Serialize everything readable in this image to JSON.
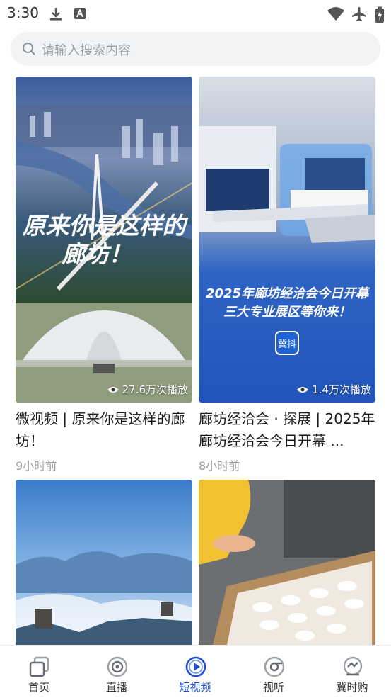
{
  "status_bar": {
    "time": "3:30"
  },
  "search": {
    "placeholder": "请输入搜索内容"
  },
  "feed": [
    {
      "overlay_text": "原来你是这样的廊坊！",
      "play_count": "27.6万次播放",
      "title": "微视频 | 原来你是这样的廊坊！",
      "time": "9小时前"
    },
    {
      "overlay_text": "2025年廊坊经洽会今日开幕 三大专业展区等你来！",
      "badge": "冀抖",
      "play_count": "1.4万次播放",
      "title": "廊坊经洽会 · 探展 | 2025年廊坊经洽会今日开幕 ...",
      "time": "8小时前"
    },
    {
      "title": "",
      "time": ""
    },
    {
      "title": "",
      "time": ""
    }
  ],
  "tabbar": {
    "items": [
      {
        "label": "首页",
        "icon": "home-icon"
      },
      {
        "label": "直播",
        "icon": "live-icon"
      },
      {
        "label": "短视频",
        "icon": "short-video-icon",
        "active": true
      },
      {
        "label": "视听",
        "icon": "audio-visual-icon"
      },
      {
        "label": "冀时购",
        "icon": "shop-icon"
      }
    ]
  },
  "colors": {
    "accent": "#1f4fd6",
    "text": "#1a1a1a",
    "muted": "#9a9ea6"
  }
}
